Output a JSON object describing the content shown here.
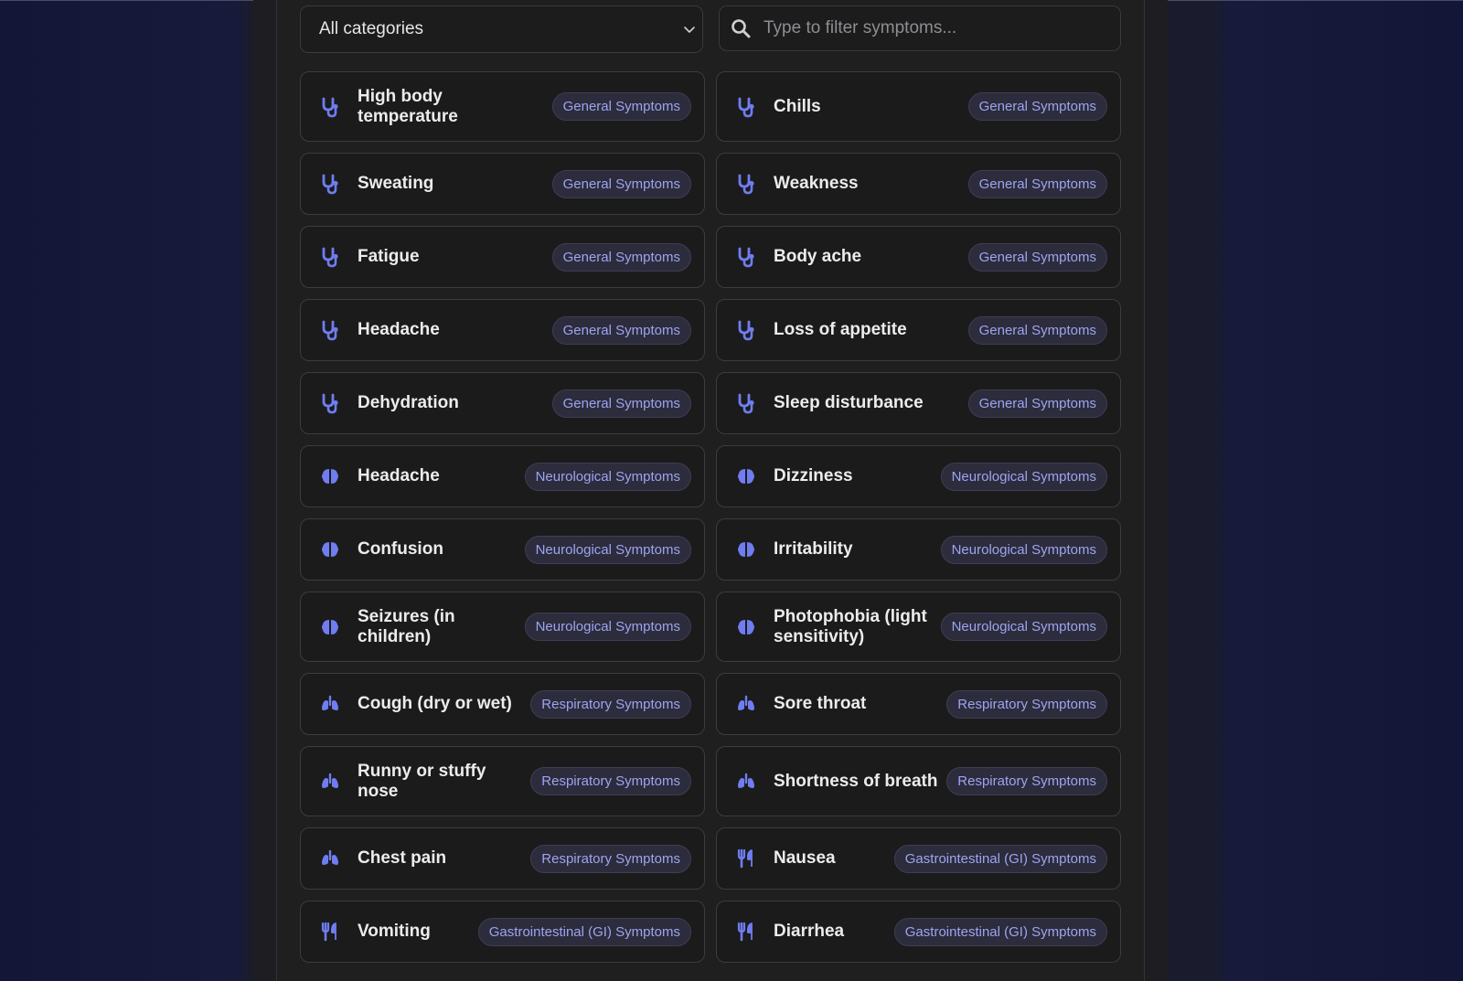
{
  "filters": {
    "category_select": {
      "selected": "All categories"
    },
    "search": {
      "placeholder": "Type to filter symptoms..."
    }
  },
  "colors": {
    "accent": "#6f7df0",
    "badge_text": "#9ea4f0",
    "background": "#1a1c2e"
  },
  "symptoms": [
    {
      "name": "High body temperature",
      "category": "General Symptoms",
      "icon": "stethoscope-icon"
    },
    {
      "name": "Chills",
      "category": "General Symptoms",
      "icon": "stethoscope-icon"
    },
    {
      "name": "Sweating",
      "category": "General Symptoms",
      "icon": "stethoscope-icon"
    },
    {
      "name": "Weakness",
      "category": "General Symptoms",
      "icon": "stethoscope-icon"
    },
    {
      "name": "Fatigue",
      "category": "General Symptoms",
      "icon": "stethoscope-icon"
    },
    {
      "name": "Body ache",
      "category": "General Symptoms",
      "icon": "stethoscope-icon"
    },
    {
      "name": "Headache",
      "category": "General Symptoms",
      "icon": "stethoscope-icon"
    },
    {
      "name": "Loss of appetite",
      "category": "General Symptoms",
      "icon": "stethoscope-icon"
    },
    {
      "name": "Dehydration",
      "category": "General Symptoms",
      "icon": "stethoscope-icon"
    },
    {
      "name": "Sleep disturbance",
      "category": "General Symptoms",
      "icon": "stethoscope-icon"
    },
    {
      "name": "Headache",
      "category": "Neurological Symptoms",
      "icon": "brain-icon"
    },
    {
      "name": "Dizziness",
      "category": "Neurological Symptoms",
      "icon": "brain-icon"
    },
    {
      "name": "Confusion",
      "category": "Neurological Symptoms",
      "icon": "brain-icon"
    },
    {
      "name": "Irritability",
      "category": "Neurological Symptoms",
      "icon": "brain-icon"
    },
    {
      "name": "Seizures (in children)",
      "category": "Neurological Symptoms",
      "icon": "brain-icon"
    },
    {
      "name": "Photophobia (light sensitivity)",
      "category": "Neurological Symptoms",
      "icon": "brain-icon"
    },
    {
      "name": "Cough (dry or wet)",
      "category": "Respiratory Symptoms",
      "icon": "lungs-icon"
    },
    {
      "name": "Sore throat",
      "category": "Respiratory Symptoms",
      "icon": "lungs-icon"
    },
    {
      "name": "Runny or stuffy nose",
      "category": "Respiratory Symptoms",
      "icon": "lungs-icon"
    },
    {
      "name": "Shortness of breath",
      "category": "Respiratory Symptoms",
      "icon": "lungs-icon"
    },
    {
      "name": "Chest pain",
      "category": "Respiratory Symptoms",
      "icon": "lungs-icon"
    },
    {
      "name": "Nausea",
      "category": "Gastrointestinal (GI) Symptoms",
      "icon": "utensils-icon"
    },
    {
      "name": "Vomiting",
      "category": "Gastrointestinal (GI) Symptoms",
      "icon": "utensils-icon"
    },
    {
      "name": "Diarrhea",
      "category": "Gastrointestinal (GI) Symptoms",
      "icon": "utensils-icon"
    }
  ]
}
